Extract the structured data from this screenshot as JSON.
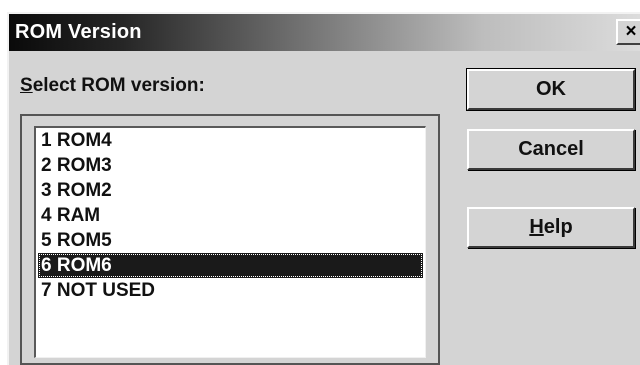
{
  "dialog": {
    "title": "ROM Version",
    "close_glyph": "×",
    "prompt": {
      "mnemonic": "S",
      "rest": "elect ROM version:"
    },
    "selected_index": 5,
    "items": [
      "1 ROM4",
      "2 ROM3",
      "3 ROM2",
      "4 RAM",
      "5 ROM5",
      "6 ROM6",
      "7 NOT USED"
    ],
    "buttons": {
      "ok": "OK",
      "cancel": "Cancel",
      "help": {
        "mnemonic": "H",
        "rest": "elp"
      }
    }
  },
  "colors": {
    "face": "#d4d4d4",
    "selection": "#1a1a1a",
    "title_gradient_start": "#0a0a0a",
    "title_gradient_end": "#dcdcdc"
  }
}
